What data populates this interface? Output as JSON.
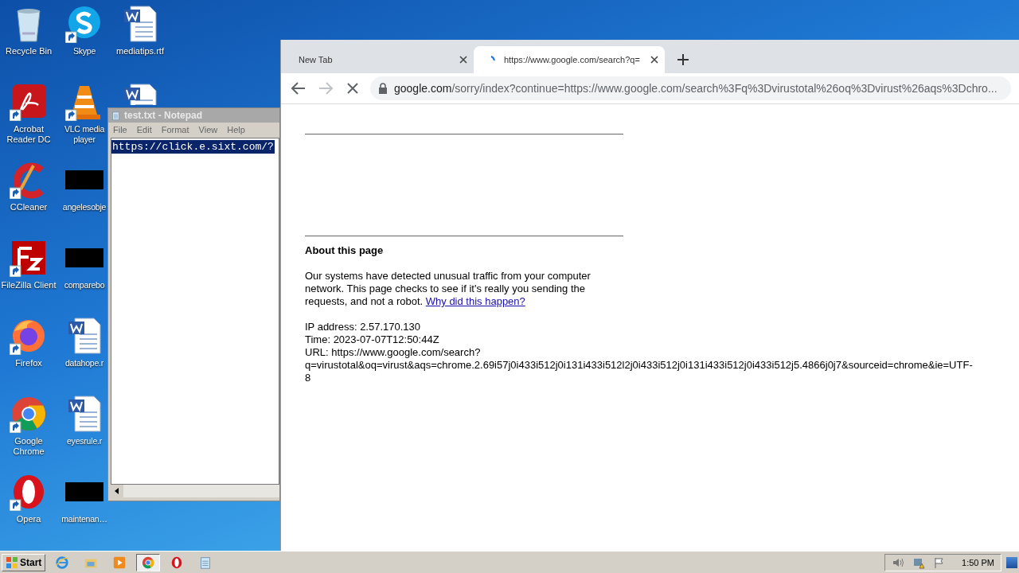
{
  "desktop": {
    "icons": [
      {
        "label": "Recycle Bin",
        "kind": "recycle",
        "shortcut": false
      },
      {
        "label": "Acrobat Reader DC",
        "kind": "acrobat",
        "shortcut": true
      },
      {
        "label": "CCleaner",
        "kind": "ccleaner",
        "shortcut": true
      },
      {
        "label": "FileZilla Client",
        "kind": "filezilla",
        "shortcut": true
      },
      {
        "label": "Firefox",
        "kind": "firefox",
        "shortcut": true
      },
      {
        "label": "Google Chrome",
        "kind": "chrome",
        "shortcut": true
      },
      {
        "label": "Opera",
        "kind": "opera",
        "shortcut": true
      },
      {
        "label": "Skype",
        "kind": "skype",
        "shortcut": true
      },
      {
        "label": "VLC media player",
        "kind": "vlc",
        "shortcut": true
      },
      {
        "label": "angelesobje",
        "kind": "redacted",
        "shortcut": false
      },
      {
        "label": "comparebo",
        "kind": "redacted",
        "shortcut": false
      },
      {
        "label": "datahope.r",
        "kind": "word",
        "shortcut": false
      },
      {
        "label": "eyesrule.r",
        "kind": "word",
        "shortcut": false
      },
      {
        "label": "maintenan…",
        "kind": "redacted",
        "shortcut": false
      },
      {
        "label": "mediatips.rtf",
        "kind": "word",
        "shortcut": false
      },
      {
        "kind": "word"
      }
    ]
  },
  "notepad": {
    "title": "test.txt - Notepad",
    "menu": [
      "File",
      "Edit",
      "Format",
      "View",
      "Help"
    ],
    "text": "https://click.e.sixt.com/?",
    "selected": true
  },
  "browser": {
    "tabs": [
      {
        "title": "New Tab",
        "selected": false,
        "loading": false
      },
      {
        "title": "https://www.google.com/search?q=",
        "selected": true,
        "loading": true
      }
    ],
    "loading": true,
    "forward_disabled": true,
    "address": {
      "host": "google.com",
      "path": "/sorry/index?continue=https://www.google.com/search%3Fq%3Dvirustotal%26oq%3Dvirust%26aqs%3Dchro..."
    },
    "page": {
      "heading": "About this page",
      "paragraph": "Our systems have detected unusual traffic from your computer network. This page checks to see if it's really you sending the requests, and not a robot.",
      "link": "Why did this happen?",
      "details": [
        "IP address: 2.57.170.130",
        "Time: 2023-07-07T12:50:44Z",
        "URL: https://www.google.com/search?q=virustotal&oq=virust&aqs=chrome.2.69i57j0i433i512j0i131i433i512l2j0i433i512j0i131i433i512j0i433i512j5.4866j0j7&sourceid=chrome&ie=UTF-8"
      ]
    }
  },
  "taskbar": {
    "start": "Start",
    "items": [
      {
        "kind": "ie",
        "selected": false
      },
      {
        "kind": "explorer",
        "selected": false
      },
      {
        "kind": "media",
        "selected": false
      },
      {
        "kind": "chrome",
        "selected": true
      },
      {
        "kind": "opera",
        "selected": false
      },
      {
        "kind": "notepad",
        "selected": false
      }
    ],
    "time": "1:50 PM"
  }
}
